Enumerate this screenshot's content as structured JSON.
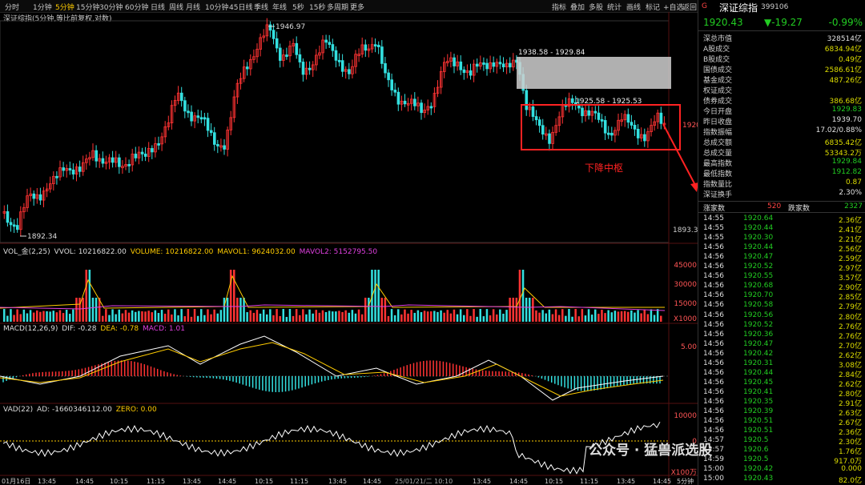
{
  "toolbar": {
    "timeframes": [
      "分时",
      "1分钟",
      "5分钟",
      "15分钟",
      "30分钟",
      "60分钟",
      "日线",
      "周线",
      "月线",
      "10分钟",
      "45日线",
      "季线",
      "年线",
      "5秒",
      "15秒",
      "多周期",
      "更多"
    ],
    "active_timeframe": "5分钟",
    "right_tools": [
      "指标",
      "叠加",
      "多股",
      "统计",
      "画线",
      "标记",
      "+自选",
      "返回"
    ]
  },
  "chart_subtitle": "深证综指(5分钟,等比前复权,对数)",
  "main_chart": {
    "high_label": "1946.97",
    "low_label": "1892.34",
    "upper_zone_label": "1938.58 - 1929.84",
    "pivot_range_label": "1925.58 - 1925.53",
    "pivot_annotation": "下降中枢",
    "axis_right_label": "1920",
    "axis_bottom_label": "1893.3"
  },
  "volume_panel": {
    "title": "VOL_金(2,25)",
    "vvol": "VVOL: 10216822.00",
    "volume": "VOLUME: 10216822.00",
    "mavol1": "MAVOL1: 9624032.00",
    "mavol2": "MAVOL2: 5152795.50",
    "ticks": [
      "45000",
      "30000",
      "15000",
      "X1000"
    ]
  },
  "macd_panel": {
    "title": "MACD(12,26,9)",
    "dif": "DIF: -0.28",
    "dea": "DEA: -0.78",
    "macd": "MACD: 1.01",
    "tick": "5.00"
  },
  "vad_panel": {
    "title": "VAD(22)",
    "ad": "AD: -1660346112.00",
    "zero": "ZERO: 0.00",
    "ticks": [
      "10000",
      "0",
      "X100万"
    ]
  },
  "time_axis": [
    "01月16日",
    "13:45",
    "14:45",
    "10:15",
    "11:15",
    "13:45",
    "14:45",
    "10:15",
    "11:15",
    "13:45",
    "14:45",
    "25/01/21/二 10:10",
    "13:45",
    "14:45",
    "10:15",
    "11:15",
    "13:45",
    "14:45"
  ],
  "period_label": "5分钟",
  "quote": {
    "index_marker": "G",
    "name": "深证综指",
    "code": "399106",
    "price": "1920.43",
    "change": "▼-19.27",
    "pct": "-0.99%",
    "rows": [
      {
        "label": "深总市值",
        "value": "328514亿",
        "color": "white"
      },
      {
        "label": "A股成交",
        "value": "6834.94亿",
        "color": "yellow"
      },
      {
        "label": "B股成交",
        "value": "0.49亿",
        "color": "yellow"
      },
      {
        "label": "国债成交",
        "value": "2586.61亿",
        "color": "yellow"
      },
      {
        "label": "基金成交",
        "value": "487.26亿",
        "color": "yellow"
      },
      {
        "label": "权证成交",
        "value": "",
        "color": "yellow"
      },
      {
        "label": "债券成交",
        "value": "386.68亿",
        "color": "yellow"
      },
      {
        "label": "今日开盘",
        "value": "1929.83",
        "color": "green"
      },
      {
        "label": "昨日收盘",
        "value": "1939.70",
        "color": "white"
      },
      {
        "label": "指数振幅",
        "value": "17.02/0.88%",
        "color": "white"
      },
      {
        "label": "总成交额",
        "value": "6835.42亿",
        "color": "yellow"
      },
      {
        "label": "总成交量",
        "value": "53343.2万",
        "color": "yellow"
      },
      {
        "label": "最高指数",
        "value": "1929.84",
        "color": "green"
      },
      {
        "label": "最低指数",
        "value": "1912.82",
        "color": "green"
      },
      {
        "label": "指数量比",
        "value": "0.87",
        "color": "yellow"
      },
      {
        "label": "深证换手",
        "value": "2.30%",
        "color": "white"
      }
    ],
    "up_label": "涨家数",
    "up_count": "520",
    "down_label": "跌家数",
    "down_count": "2327"
  },
  "ticks": [
    {
      "time": "14:55",
      "price": "1920.64",
      "vol": "2.36亿"
    },
    {
      "time": "14:55",
      "price": "1920.44",
      "vol": "2.41亿"
    },
    {
      "time": "14:55",
      "price": "1920.30",
      "vol": "2.21亿"
    },
    {
      "time": "14:56",
      "price": "1920.44",
      "vol": "2.56亿"
    },
    {
      "time": "14:56",
      "price": "1920.47",
      "vol": "2.59亿"
    },
    {
      "time": "14:56",
      "price": "1920.52",
      "vol": "2.97亿"
    },
    {
      "time": "14:56",
      "price": "1920.55",
      "vol": "3.57亿"
    },
    {
      "time": "14:56",
      "price": "1920.68",
      "vol": "2.90亿"
    },
    {
      "time": "14:56",
      "price": "1920.70",
      "vol": "2.85亿"
    },
    {
      "time": "14:56",
      "price": "1920.58",
      "vol": "2.79亿"
    },
    {
      "time": "14:56",
      "price": "1920.56",
      "vol": "2.80亿"
    },
    {
      "time": "14:56",
      "price": "1920.52",
      "vol": "2.76亿"
    },
    {
      "time": "14:56",
      "price": "1920.36",
      "vol": "2.76亿"
    },
    {
      "time": "14:56",
      "price": "1920.47",
      "vol": "2.70亿"
    },
    {
      "time": "14:56",
      "price": "1920.42",
      "vol": "2.62亿"
    },
    {
      "time": "14:56",
      "price": "1920.31",
      "vol": "3.08亿"
    },
    {
      "time": "14:56",
      "price": "1920.44",
      "vol": "2.84亿"
    },
    {
      "time": "14:56",
      "price": "1920.45",
      "vol": "2.62亿"
    },
    {
      "time": "14:56",
      "price": "1920.41",
      "vol": "2.80亿"
    },
    {
      "time": "14:56",
      "price": "1920.35",
      "vol": "2.91亿"
    },
    {
      "time": "14:56",
      "price": "1920.39",
      "vol": "2.63亿"
    },
    {
      "time": "14:56",
      "price": "1920.51",
      "vol": "2.67亿"
    },
    {
      "time": "14:56",
      "price": "1920.51",
      "vol": "2.36亿"
    },
    {
      "time": "14:57",
      "price": "1920.5",
      "vol": "2.30亿"
    },
    {
      "time": "14:57",
      "price": "1920.6",
      "vol": "1.76亿"
    },
    {
      "time": "14:59",
      "price": "1920.5",
      "vol": "917.0万"
    },
    {
      "time": "15:00",
      "price": "1920.42",
      "vol": "0.000"
    },
    {
      "time": "15:00",
      "price": "1920.43",
      "vol": "82.0亿"
    }
  ],
  "watermark": "公众号 · 猛兽派选股",
  "colors": {
    "up": "#ff3333",
    "down": "#33e0e0",
    "accent": "#ffcc00",
    "annotation_red": "#ff2222"
  }
}
